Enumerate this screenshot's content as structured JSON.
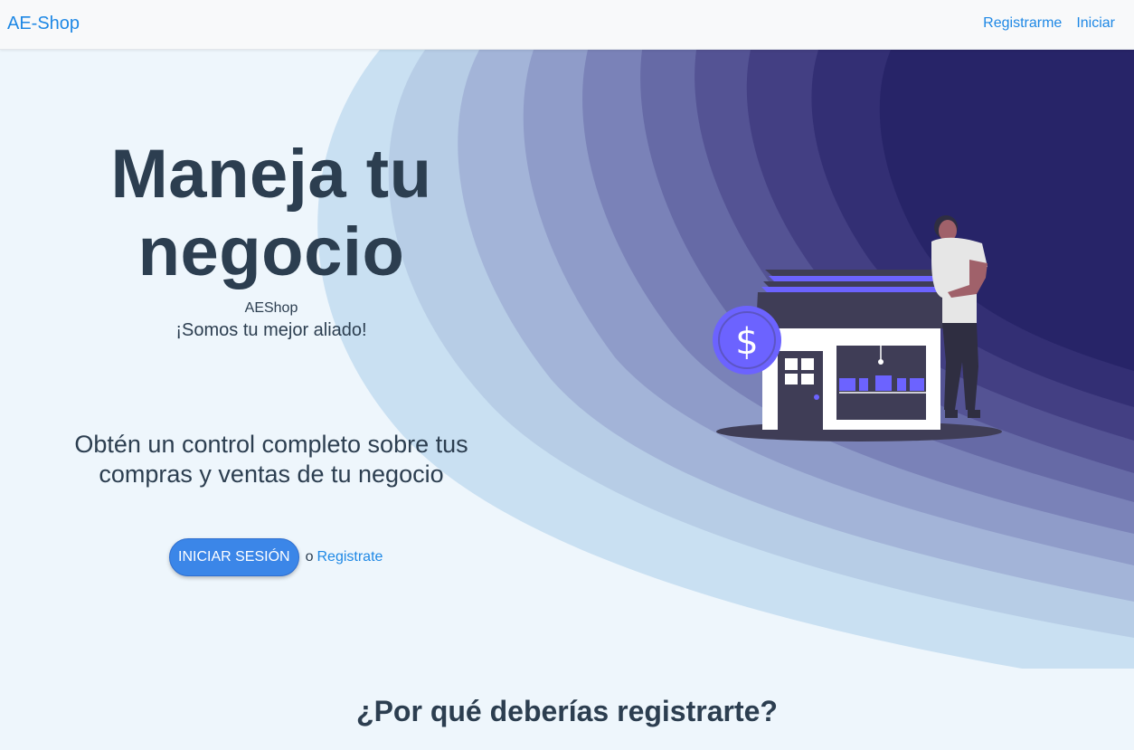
{
  "navbar": {
    "brand": "AE-Shop",
    "links": [
      "Registrarme",
      "Iniciar"
    ]
  },
  "hero": {
    "title": "Maneja tu negocio",
    "brand_name": "AEShop",
    "tagline": "¡Somos tu mejor aliado!",
    "description": "Obtén un control completo sobre tus compras y ventas de tu negocio",
    "login_button": "INICIAR SESIÓN",
    "or_text": "o",
    "register_link": "Registrate",
    "illustration_icon": "store-with-dollar-coin-illustration"
  },
  "section": {
    "title": "¿Por qué deberías registrarte?"
  },
  "colors": {
    "brand": "#1e88e5",
    "primary_button": "#3b86e8",
    "text_dark": "#2c3e50",
    "wave_deep": "#262266",
    "accent_purple": "#6c63ff"
  }
}
